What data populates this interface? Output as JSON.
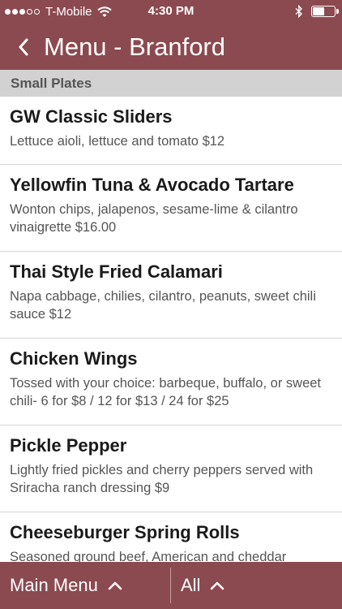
{
  "status_bar": {
    "carrier": "T-Mobile",
    "time": "4:30 PM",
    "signal_bars": 3,
    "signal_total": 5,
    "battery_level": 0.55
  },
  "nav": {
    "title": "Menu - Branford",
    "back_icon": "chevron-left-icon"
  },
  "section": {
    "title": "Small Plates"
  },
  "menu_items": [
    {
      "name": "GW Classic Sliders",
      "description": "Lettuce aioli, lettuce and tomato $12"
    },
    {
      "name": "Yellowfin Tuna & Avocado Tartare",
      "description": "Wonton chips, jalapenos, sesame-lime & cilantro vinaigrette $16.00"
    },
    {
      "name": "Thai Style Fried Calamari",
      "description": "Napa cabbage, chilies, cilantro, peanuts, sweet chili sauce $12"
    },
    {
      "name": "Chicken Wings",
      "description": "Tossed with your choice: barbeque, buffalo, or sweet chili- 6 for $8 / 12 for $13 / 24 for $25"
    },
    {
      "name": "Pickle Pepper",
      "description": "Lightly fried pickles and cherry peppers served with Sriracha ranch dressing $9"
    },
    {
      "name": "Cheeseburger Spring Rolls",
      "description": "Seasoned ground beef, American and cheddar"
    }
  ],
  "bottom_bar": {
    "main_menu_label": "Main Menu",
    "all_label": "All"
  },
  "colors": {
    "brand": "#8b4a50",
    "section_bg": "#d2d2d2",
    "text_primary": "#1a1a1a",
    "text_secondary": "#555555"
  }
}
